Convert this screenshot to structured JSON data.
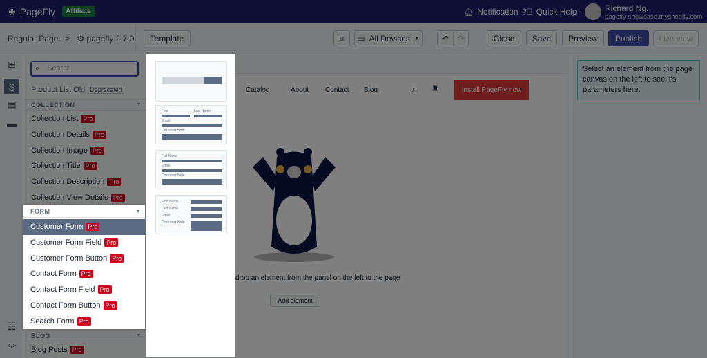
{
  "topbar": {
    "brand": "PageFly",
    "badge": "Affiliate",
    "notification": "Notification",
    "help": "Quick Help",
    "user_name": "Richard Ng.",
    "user_shop": "pagefly-showcase.myshopify.com"
  },
  "toolbar": {
    "page_type": "Regular Page",
    "separator": ">",
    "page_name": "pagefly 2.7.0",
    "template": "Template",
    "devices": "All Devices",
    "close": "Close",
    "save": "Save",
    "preview": "Preview",
    "publish": "Publish",
    "live_view": "Live view",
    "accent": "#3f4eae"
  },
  "panel": {
    "search_placeholder": "Search",
    "product_list_old": "Product List Old",
    "deprecated": "Deprecated",
    "collection_header": "COLLECTION",
    "collection_items": [
      {
        "label": "Collection List",
        "badge": "Pro"
      },
      {
        "label": "Collection Details",
        "badge": "Pro"
      },
      {
        "label": "Collection Image",
        "badge": "Pro"
      },
      {
        "label": "Collection Title",
        "badge": "Pro"
      },
      {
        "label": "Collection Description",
        "badge": "Pro"
      },
      {
        "label": "Collection View Details",
        "badge": "Pro"
      }
    ],
    "form_header": "FORM",
    "form_items": [
      {
        "label": "Customer Form",
        "badge": "Pro",
        "selected": true
      },
      {
        "label": "Customer Form Field",
        "badge": "Pro"
      },
      {
        "label": "Customer Form Button",
        "badge": "Pro"
      },
      {
        "label": "Contact Form",
        "badge": "Pro"
      },
      {
        "label": "Contact Form Field",
        "badge": "Pro"
      },
      {
        "label": "Contact Form Button",
        "badge": "Pro"
      },
      {
        "label": "Search Form",
        "badge": "Pro"
      }
    ],
    "blog_header": "BLOG",
    "blog_items": [
      {
        "label": "Blog Posts",
        "badge": "Pro"
      }
    ]
  },
  "templates": {
    "t2": {
      "first": "First",
      "last": "Last Name",
      "email": "Email",
      "note": "Customer Note"
    },
    "t3": {
      "full": "Full Name",
      "email": "Email",
      "note": "Customer Note"
    },
    "t4": {
      "first": "First Name",
      "last": "Last Name",
      "email": "Email",
      "note": "Customer Note"
    }
  },
  "canvas": {
    "nav": [
      "Catalog",
      "About",
      "Contact",
      "Blog"
    ],
    "install": "Install PageFly now",
    "empty_text": "drop an element from the panel on the left to the page",
    "add_element": "Add element"
  },
  "right": {
    "hint": "Select an element from the page canvas on the left to see it's parameters here."
  }
}
